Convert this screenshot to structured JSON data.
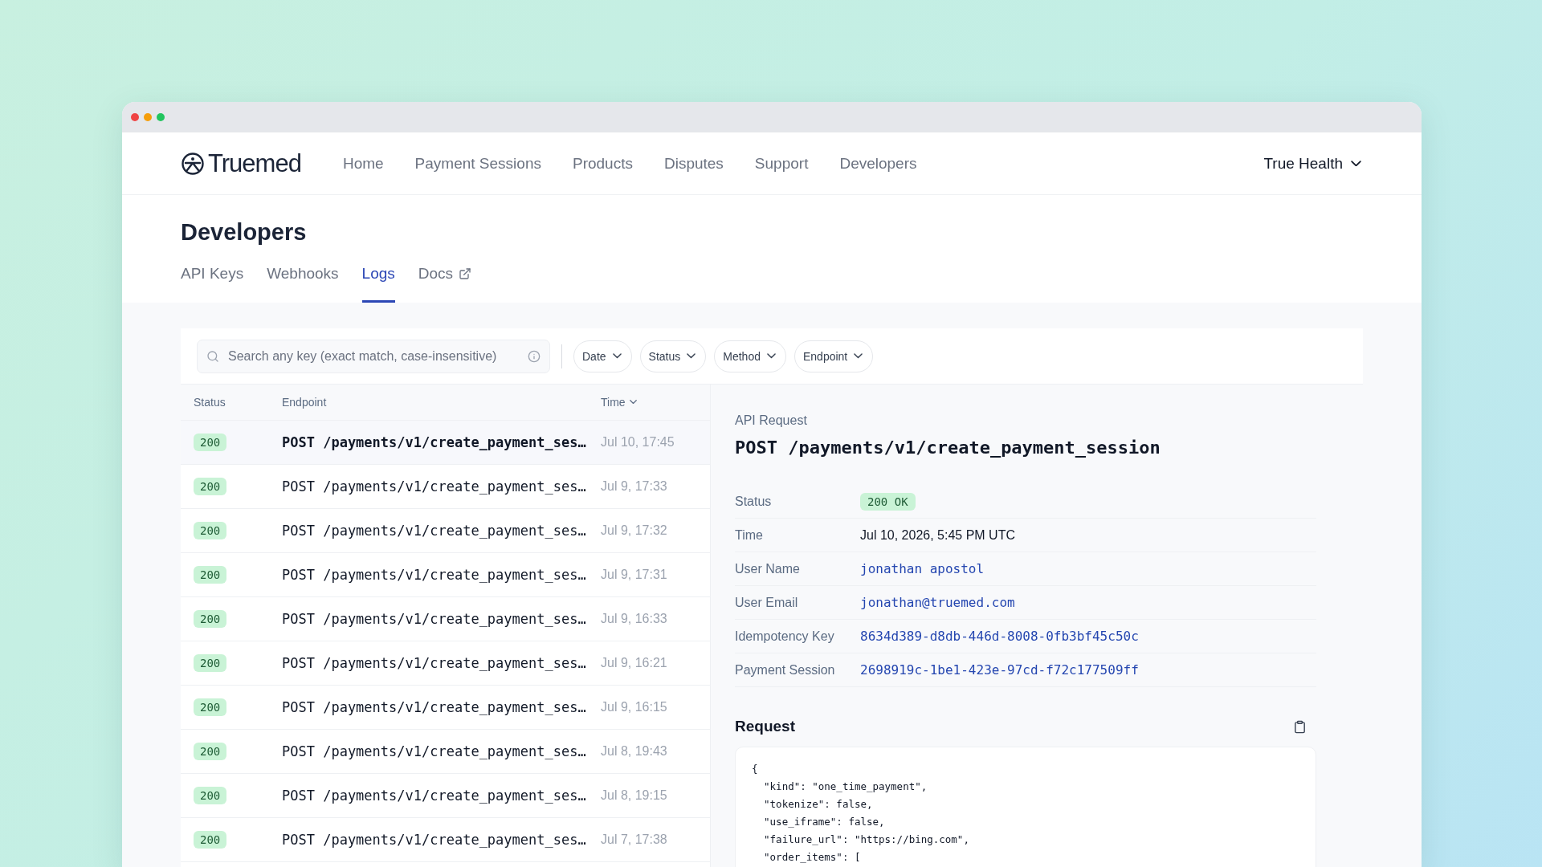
{
  "nav": {
    "brand": "Truemed",
    "items": [
      {
        "label": "Home"
      },
      {
        "label": "Payment Sessions"
      },
      {
        "label": "Products"
      },
      {
        "label": "Disputes"
      },
      {
        "label": "Support"
      },
      {
        "label": "Developers"
      }
    ],
    "account": "True Health"
  },
  "page": {
    "title": "Developers",
    "tabs": [
      {
        "label": "API Keys",
        "selected": false,
        "external": false
      },
      {
        "label": "Webhooks",
        "selected": false,
        "external": false
      },
      {
        "label": "Logs",
        "selected": true,
        "external": false
      },
      {
        "label": "Docs",
        "selected": false,
        "external": true
      }
    ]
  },
  "filters": {
    "search": {
      "placeholder": "Search any key (exact match, case-insensitive)"
    },
    "chips": [
      "Date",
      "Status",
      "Method",
      "Endpoint"
    ]
  },
  "table": {
    "columns": [
      "Status",
      "Endpoint",
      "Time"
    ],
    "rows": [
      {
        "status": "200",
        "endpoint": "POST /payments/v1/create_payment_ses…",
        "time": "Jul 10, 17:45",
        "selected": true
      },
      {
        "status": "200",
        "endpoint": "POST /payments/v1/create_payment_ses…",
        "time": "Jul 9, 17:33",
        "selected": false
      },
      {
        "status": "200",
        "endpoint": "POST /payments/v1/create_payment_ses…",
        "time": "Jul 9, 17:32",
        "selected": false
      },
      {
        "status": "200",
        "endpoint": "POST /payments/v1/create_payment_ses…",
        "time": "Jul 9, 17:31",
        "selected": false
      },
      {
        "status": "200",
        "endpoint": "POST /payments/v1/create_payment_ses…",
        "time": "Jul 9, 16:33",
        "selected": false
      },
      {
        "status": "200",
        "endpoint": "POST /payments/v1/create_payment_ses…",
        "time": "Jul 9, 16:21",
        "selected": false
      },
      {
        "status": "200",
        "endpoint": "POST /payments/v1/create_payment_ses…",
        "time": "Jul 9, 16:15",
        "selected": false
      },
      {
        "status": "200",
        "endpoint": "POST /payments/v1/create_payment_ses…",
        "time": "Jul 8, 19:43",
        "selected": false
      },
      {
        "status": "200",
        "endpoint": "POST /payments/v1/create_payment_ses…",
        "time": "Jul 8, 19:15",
        "selected": false
      },
      {
        "status": "200",
        "endpoint": "POST /payments/v1/create_payment_ses…",
        "time": "Jul 7, 17:38",
        "selected": false
      }
    ]
  },
  "detail": {
    "eyebrow": "API Request",
    "title": "POST /payments/v1/create_payment_session",
    "fields": [
      {
        "label": "Status",
        "value": "200 OK",
        "kind": "badge"
      },
      {
        "label": "Time",
        "value": "Jul 10, 2026, 5:45 PM UTC",
        "kind": "text"
      },
      {
        "label": "User Name",
        "value": "jonathan apostol",
        "kind": "link"
      },
      {
        "label": "User Email",
        "value": "jonathan@truemed.com",
        "kind": "link"
      },
      {
        "label": "Idempotency Key",
        "value": "8634d389-d8db-446d-8008-0fb3bf45c50c",
        "kind": "link"
      },
      {
        "label": "Payment Session",
        "value": "2698919c-1be1-423e-97cd-f72c177509ff",
        "kind": "link"
      }
    ],
    "request": {
      "title": "Request",
      "code": [
        "{",
        "  \"kind\": \"one_time_payment\",",
        "  \"tokenize\": false,",
        "  \"use_iframe\": false,",
        "  \"failure_url\": \"https://bing.com\",",
        "  \"order_items\": ["
      ]
    }
  }
}
